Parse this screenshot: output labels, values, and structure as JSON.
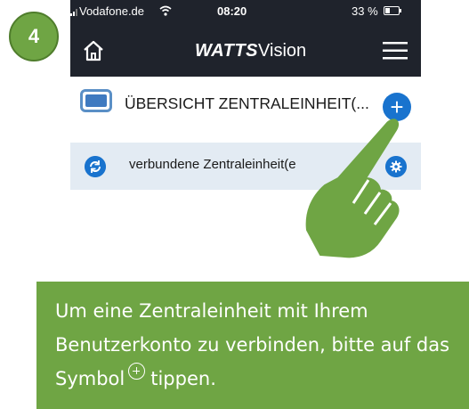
{
  "step": {
    "number": "4"
  },
  "status_bar": {
    "carrier": "Vodafone.de",
    "time": "08:20",
    "battery": "33 %"
  },
  "app": {
    "brand_bold": "WATTS",
    "brand_light": "Vision"
  },
  "overview": {
    "title": "ÜBERSICHT ZENTRALEINHEIT(...",
    "add_label": "+"
  },
  "connected": {
    "label": "verbundene Zentraleinheit(e"
  },
  "instruction": {
    "text_before_icon": "Um eine Zentraleinheit mit Ihrem Benutzerkonto zu verbinden, bitte auf das Symbol",
    "text_after_icon": "tippen."
  },
  "colors": {
    "accent_green": "#6fa544",
    "header_dark": "#1f232c",
    "button_blue": "#1973ce",
    "row_highlight": "#e3ebf3"
  },
  "icons": [
    "signal-icon",
    "wifi-icon",
    "battery-icon",
    "home-icon",
    "menu-icon",
    "controller-icon",
    "plus-icon",
    "refresh-icon",
    "gear-icon",
    "hand-pointer-icon",
    "plus-circle-icon"
  ]
}
